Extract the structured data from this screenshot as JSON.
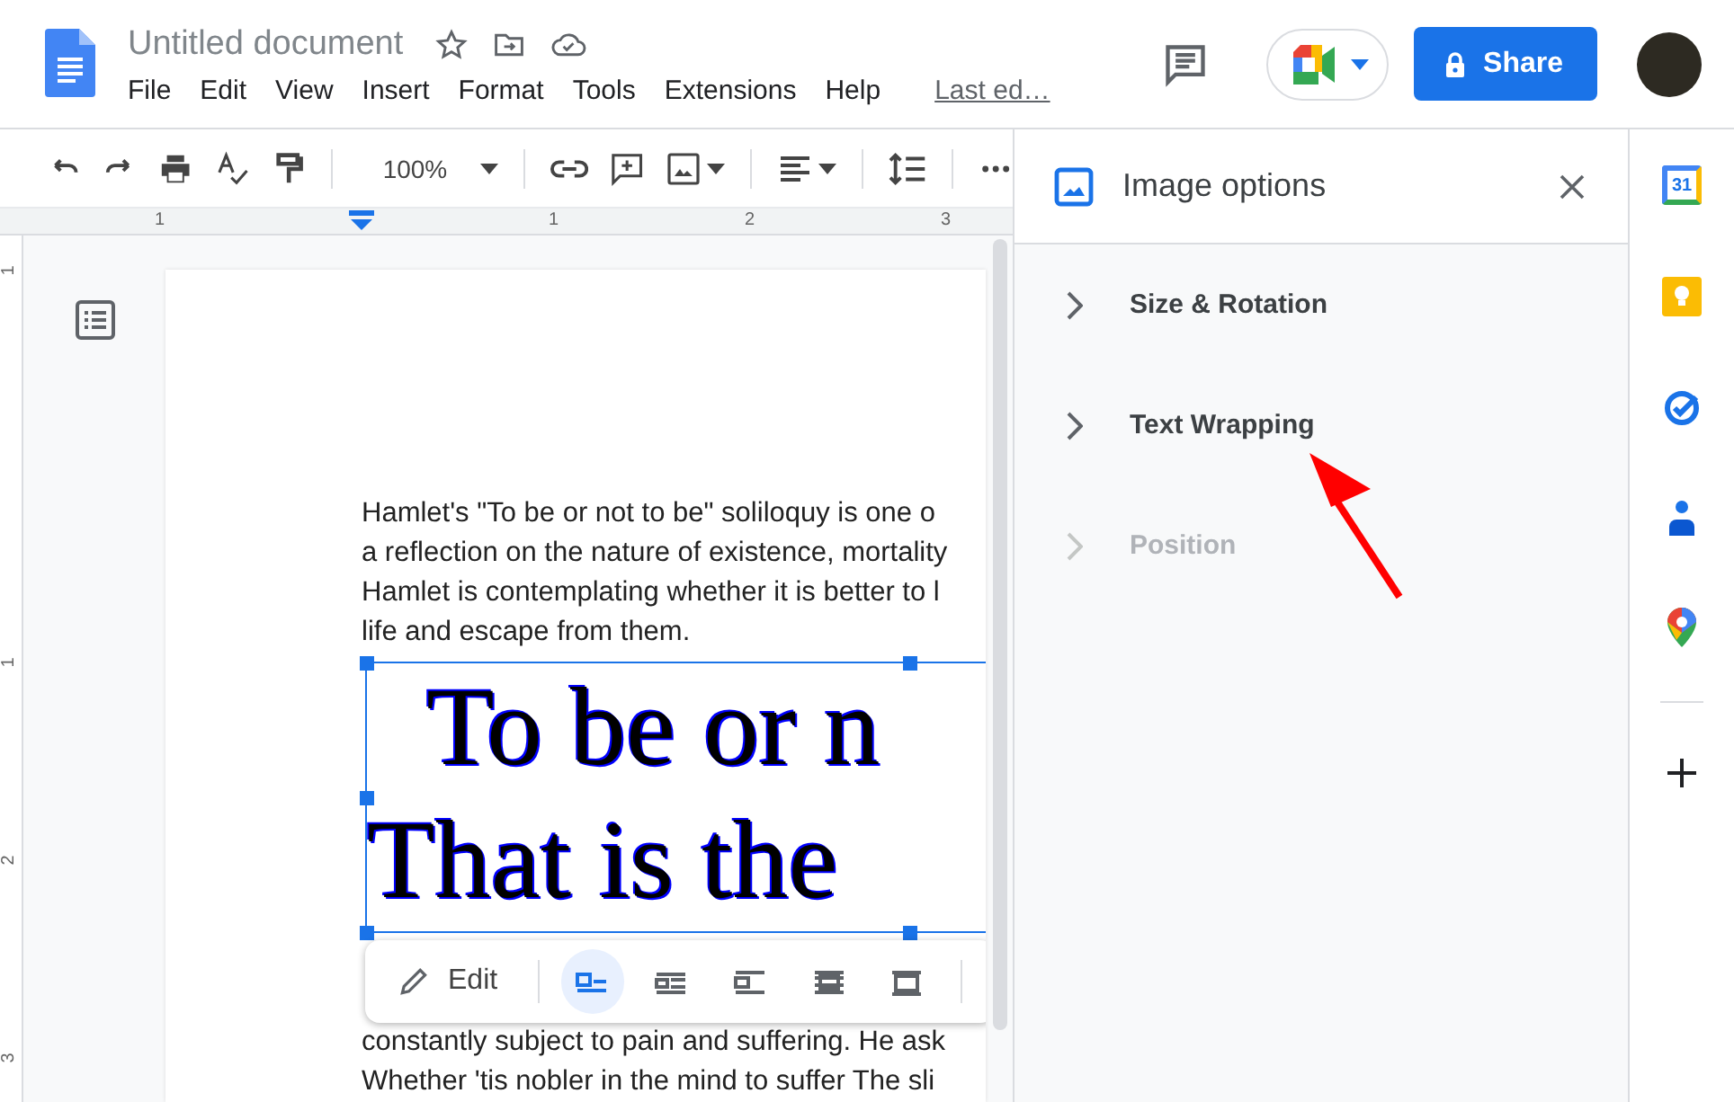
{
  "header": {
    "title": "Untitled document",
    "menus": [
      "File",
      "Edit",
      "View",
      "Insert",
      "Format",
      "Tools",
      "Extensions",
      "Help"
    ],
    "last_edit": "Last ed…",
    "share": "Share"
  },
  "toolbar": {
    "zoom": "100%"
  },
  "ruler": {
    "horizontal": [
      "1",
      "1",
      "2",
      "3"
    ],
    "vertical": [
      "1",
      "1",
      "2",
      "3"
    ]
  },
  "document": {
    "paragraph_1": [
      "Hamlet's \"To be or not to be\" soliloquy is one o",
      "a reflection on the nature of existence, mortality",
      "Hamlet is contemplating whether it is better to l",
      "life and escape from them."
    ],
    "image_lines": [
      "To be or n",
      "That is the"
    ],
    "paragraph_2": [
      "constantly subject to pain and suffering. He ask",
      "Whether 'tis nobler in the mind to suffer The sli"
    ]
  },
  "image_toolbar": {
    "edit": "Edit",
    "wrap_modes": [
      {
        "kind": "inline",
        "selected": true
      },
      {
        "kind": "wrap",
        "selected": false
      },
      {
        "kind": "break",
        "selected": false
      },
      {
        "kind": "behind",
        "selected": false
      },
      {
        "kind": "front",
        "selected": false
      }
    ]
  },
  "panel": {
    "title": "Image options",
    "sections": [
      {
        "label": "Size & Rotation",
        "disabled": false
      },
      {
        "label": "Text Wrapping",
        "disabled": false
      },
      {
        "label": "Position",
        "disabled": true
      }
    ]
  },
  "rail": {
    "calendar_day": "31"
  }
}
